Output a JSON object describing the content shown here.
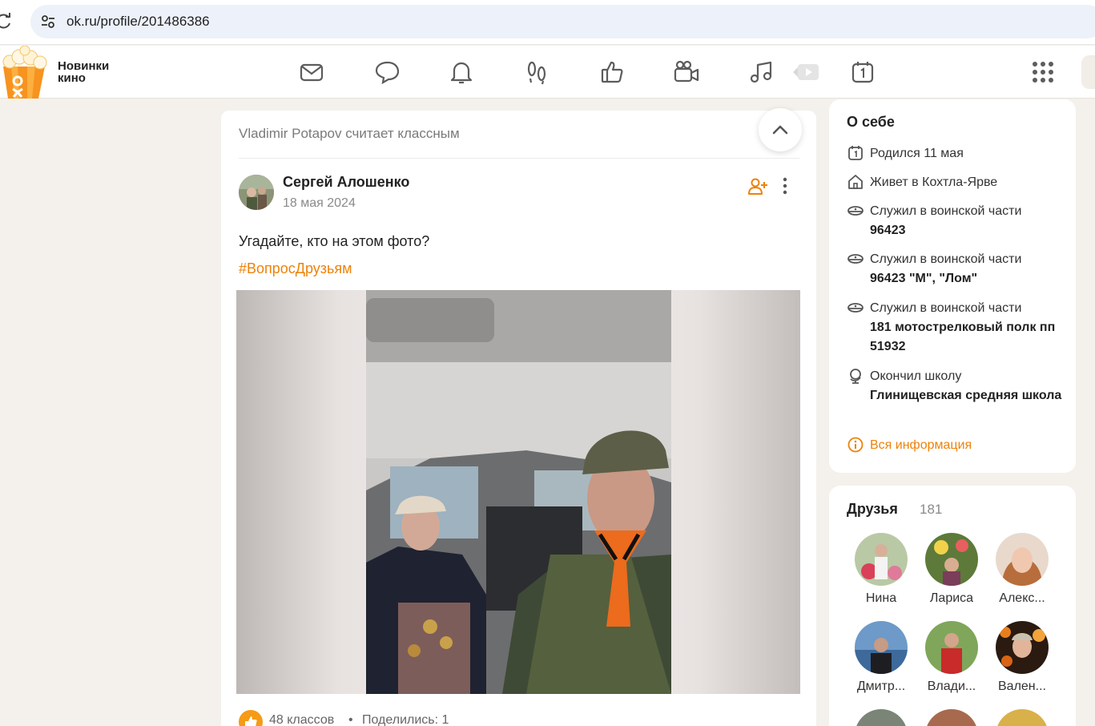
{
  "browser": {
    "url": "ok.ru/profile/201486386"
  },
  "header": {
    "promo_text": "Новинки кино",
    "nav": [
      {
        "icon": "mail-icon"
      },
      {
        "icon": "chat-icon"
      },
      {
        "icon": "bell-icon"
      },
      {
        "icon": "footprints-icon"
      },
      {
        "icon": "thumbs-up-icon"
      },
      {
        "icon": "video-camera-icon"
      },
      {
        "icon": "music-icon"
      },
      {
        "icon": "play-icon"
      },
      {
        "icon": "calendar-icon"
      },
      {
        "icon": "apps-grid-icon"
      }
    ],
    "accent": "#ee8208"
  },
  "feed": {
    "liked_by": "Vladimir Potapov считает классным",
    "post": {
      "author": "Сергей Алошенко",
      "date": "18 мая 2024",
      "text": "Угадайте, кто на этом фото?",
      "hashtag": "#ВопросДрузьям",
      "likes": "48 классов",
      "separator": "•",
      "shares": "Поделились: 1"
    }
  },
  "about": {
    "title": "О себе",
    "items": [
      {
        "icon": "birthday-calendar-icon",
        "text": "Родился 11 мая",
        "bold": ""
      },
      {
        "icon": "home-icon",
        "text": "Живет в Кохтла-Ярве",
        "bold": ""
      },
      {
        "icon": "military-cap-icon",
        "text": "Служил в воинской части",
        "bold": "96423"
      },
      {
        "icon": "military-cap-icon",
        "text": "Служил в воинской части",
        "bold": "96423 \"М\", \"Лом\""
      },
      {
        "icon": "military-cap-icon",
        "text": "Служил в воинской части",
        "bold": "181 мотострелковый полк пп 51932"
      },
      {
        "icon": "globe-school-icon",
        "text": "Окончил школу",
        "bold": "Глинищевская средняя школа"
      }
    ],
    "all_info": "Вся информация"
  },
  "friends": {
    "title": "Друзья",
    "count": "181",
    "list": [
      {
        "name": "Нина"
      },
      {
        "name": "Лариса"
      },
      {
        "name": "Алекс..."
      },
      {
        "name": "Дмитр..."
      },
      {
        "name": "Влади..."
      },
      {
        "name": "Вален..."
      }
    ]
  }
}
